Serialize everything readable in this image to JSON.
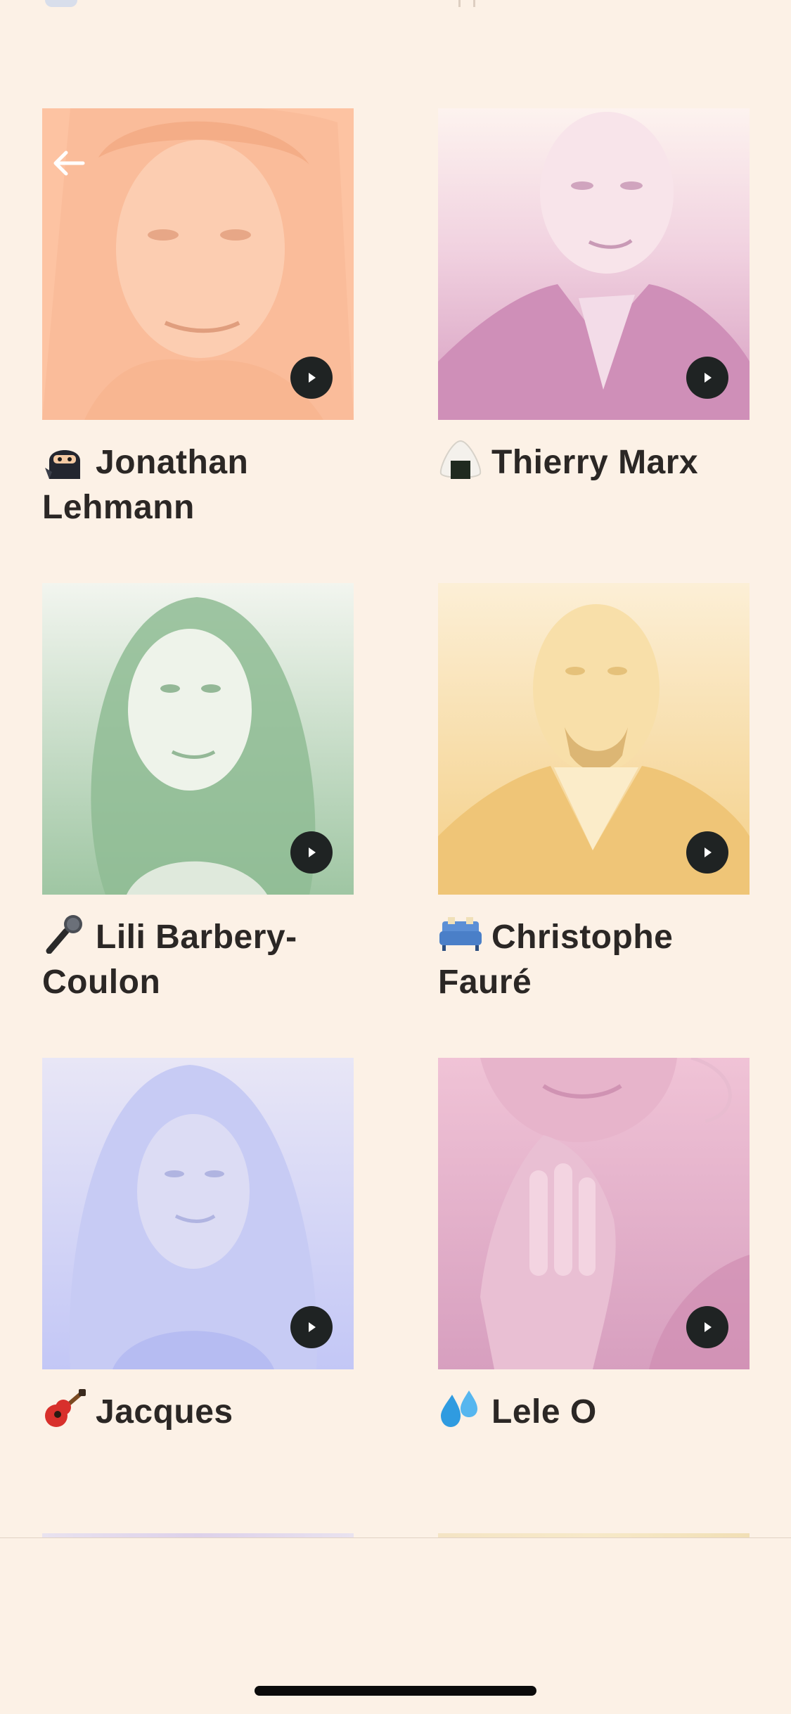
{
  "navigation": {
    "back_icon": "arrow-left-icon"
  },
  "profiles": [
    {
      "emoji_icon": "ninja-emoji-icon",
      "name": "Jonathan Lehmann",
      "tint": "#fbc1a0",
      "play_icon": "play-icon"
    },
    {
      "emoji_icon": "rice-ball-emoji-icon",
      "name": "Thierry Marx",
      "tint": "#dca3c6",
      "play_icon": "play-icon"
    },
    {
      "emoji_icon": "microphone-emoji-icon",
      "name": "Lili Barbery-Coulon",
      "tint": "#a3c9a6",
      "play_icon": "play-icon"
    },
    {
      "emoji_icon": "couch-emoji-icon",
      "name": "Christophe Fauré",
      "tint": "#f7d58f",
      "play_icon": "play-icon"
    },
    {
      "emoji_icon": "guitar-emoji-icon",
      "name": "Jacques",
      "tint": "#c2c8f6",
      "play_icon": "play-icon"
    },
    {
      "emoji_icon": "sweat-droplets-emoji-icon",
      "name": "Lele O",
      "tint": "#dea5c2",
      "play_icon": "play-icon"
    }
  ]
}
